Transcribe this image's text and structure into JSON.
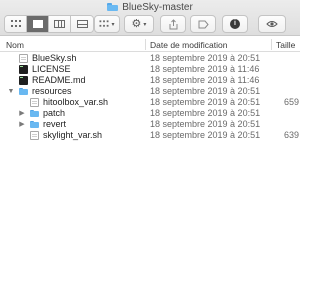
{
  "window": {
    "title": "BlueSky-master"
  },
  "toolbar": {
    "view_icons": [
      "icon-view-icon",
      "list-view-icon",
      "column-view-icon",
      "gallery-view-icon"
    ],
    "group_icon": "group-icon",
    "action_icon": "gear-icon",
    "share_icon": "share-icon",
    "tags_icon": "tag-icon",
    "info_icon": "info-icon",
    "eye_icon": "eye-icon"
  },
  "columns": {
    "name": "Nom",
    "date": "Date de modification",
    "size": "Taille"
  },
  "files": [
    {
      "name": "BlueSky.sh",
      "date": "18 septembre 2019 à 20:51",
      "size": "",
      "kind": "doc",
      "depth": 0,
      "expandable": false
    },
    {
      "name": "LICENSE",
      "date": "18 septembre 2019 à 11:46",
      "size": "",
      "kind": "exec",
      "depth": 0,
      "expandable": false
    },
    {
      "name": "README.md",
      "date": "18 septembre 2019 à 11:46",
      "size": "",
      "kind": "exec",
      "depth": 0,
      "expandable": false
    },
    {
      "name": "resources",
      "date": "18 septembre 2019 à 20:51",
      "size": "",
      "kind": "folder",
      "depth": 0,
      "expandable": true,
      "expanded": true
    },
    {
      "name": "hitoolbox_var.sh",
      "date": "18 septembre 2019 à 20:51",
      "size": "659",
      "kind": "doc",
      "depth": 1,
      "expandable": false
    },
    {
      "name": "patch",
      "date": "18 septembre 2019 à 20:51",
      "size": "",
      "kind": "folder",
      "depth": 1,
      "expandable": true,
      "expanded": false
    },
    {
      "name": "revert",
      "date": "18 septembre 2019 à 20:51",
      "size": "",
      "kind": "folder",
      "depth": 1,
      "expandable": true,
      "expanded": false
    },
    {
      "name": "skylight_var.sh",
      "date": "18 septembre 2019 à 20:51",
      "size": "639",
      "kind": "doc",
      "depth": 1,
      "expandable": false
    }
  ]
}
